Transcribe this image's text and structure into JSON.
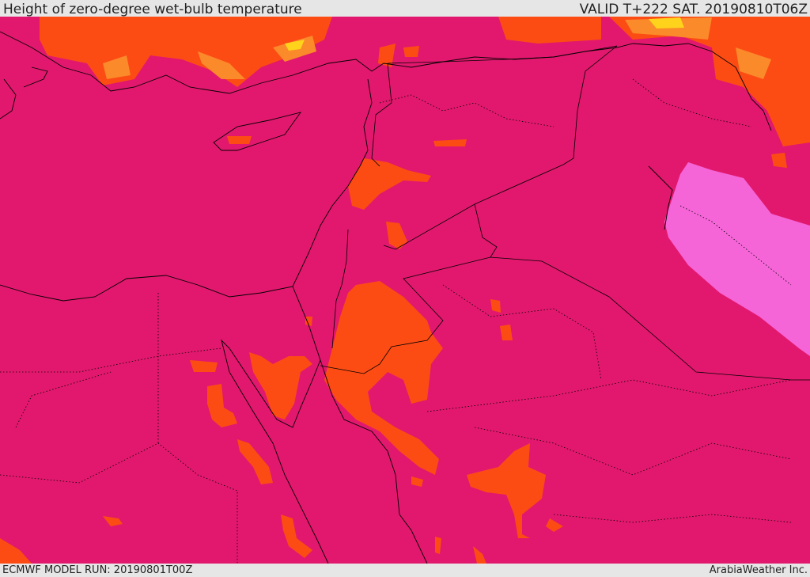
{
  "header": {
    "title": "Height of zero-degree wet-bulb temperature",
    "valid": "VALID T+222 SAT. 20190810T06Z"
  },
  "footer": {
    "model_run": "ECMWF MODEL RUN: 20190801T00Z",
    "credit": "ArabiaWeather Inc."
  },
  "colors": {
    "base": "#e2186e",
    "orange": "#fc4c14",
    "light_orange": "#fb8a2a",
    "yellow": "#ffd31c",
    "pink": "#f565d8",
    "border": "#000000",
    "header_bg": "#e6e6e6"
  }
}
